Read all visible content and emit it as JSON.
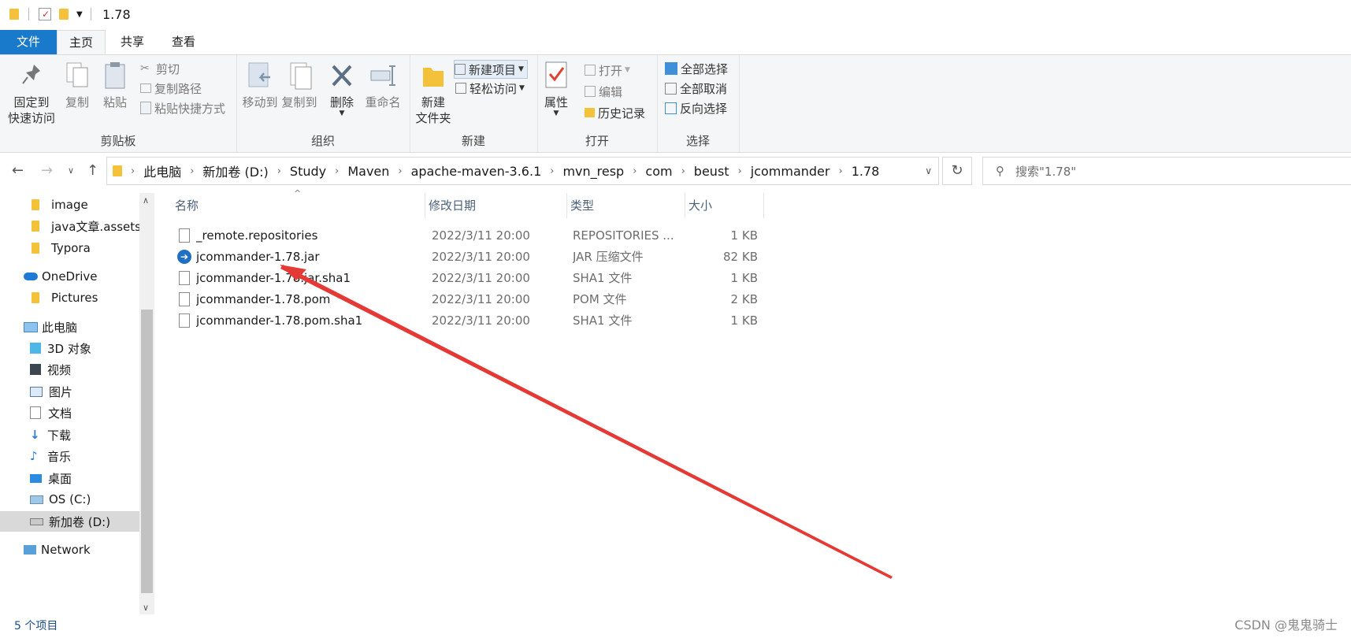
{
  "window": {
    "title": "1.78"
  },
  "tabs": {
    "file": "文件",
    "home": "主页",
    "share": "共享",
    "view": "查看"
  },
  "ribbon": {
    "clipboard": {
      "label": "剪贴板",
      "pin_line1": "固定到",
      "pin_line2": "快速访问",
      "copy": "复制",
      "paste": "粘贴",
      "cut": "剪切",
      "copy_path": "复制路径",
      "paste_shortcut": "粘贴快捷方式"
    },
    "organize": {
      "label": "组织",
      "move_to": "移动到",
      "copy_to": "复制到",
      "delete": "删除",
      "rename": "重命名"
    },
    "new": {
      "label": "新建",
      "new_folder_line1": "新建",
      "new_folder_line2": "文件夹",
      "new_item": "新建项目",
      "easy_access": "轻松访问"
    },
    "open": {
      "label": "打开",
      "properties": "属性",
      "open": "打开",
      "edit": "编辑",
      "history": "历史记录"
    },
    "select": {
      "label": "选择",
      "select_all": "全部选择",
      "select_none": "全部取消",
      "invert": "反向选择"
    }
  },
  "address": {
    "crumbs": [
      "此电脑",
      "新加卷 (D:)",
      "Study",
      "Maven",
      "apache-maven-3.6.1",
      "mvn_resp",
      "com",
      "beust",
      "jcommander",
      "1.78"
    ],
    "search_placeholder": "搜索\"1.78\""
  },
  "sidebar": {
    "items": [
      "image",
      "java文章.assets",
      "Typora",
      "OneDrive",
      "Pictures",
      "此电脑",
      "3D 对象",
      "视频",
      "图片",
      "文档",
      "下载",
      "音乐",
      "桌面",
      "OS (C:)",
      "新加卷 (D:)",
      "Network"
    ]
  },
  "list": {
    "columns": [
      "名称",
      "修改日期",
      "类型",
      "大小"
    ],
    "rows": [
      {
        "name": "_remote.repositories",
        "date": "2022/3/11 20:00",
        "type": "REPOSITORIES ...",
        "size": "1 KB",
        "icon": "file-icon"
      },
      {
        "name": "jcommander-1.78.jar",
        "date": "2022/3/11 20:00",
        "type": "JAR 压缩文件",
        "size": "82 KB",
        "icon": "jar-icon"
      },
      {
        "name": "jcommander-1.78.jar.sha1",
        "date": "2022/3/11 20:00",
        "type": "SHA1 文件",
        "size": "1 KB",
        "icon": "file-icon"
      },
      {
        "name": "jcommander-1.78.pom",
        "date": "2022/3/11 20:00",
        "type": "POM 文件",
        "size": "2 KB",
        "icon": "file-icon"
      },
      {
        "name": "jcommander-1.78.pom.sha1",
        "date": "2022/3/11 20:00",
        "type": "SHA1 文件",
        "size": "1 KB",
        "icon": "file-icon"
      }
    ]
  },
  "status": {
    "count": "5 个项目"
  },
  "watermark": "CSDN @鬼鬼骑士",
  "colors": {
    "accent": "#1979ca",
    "annotation_arrow": "#e53935"
  }
}
